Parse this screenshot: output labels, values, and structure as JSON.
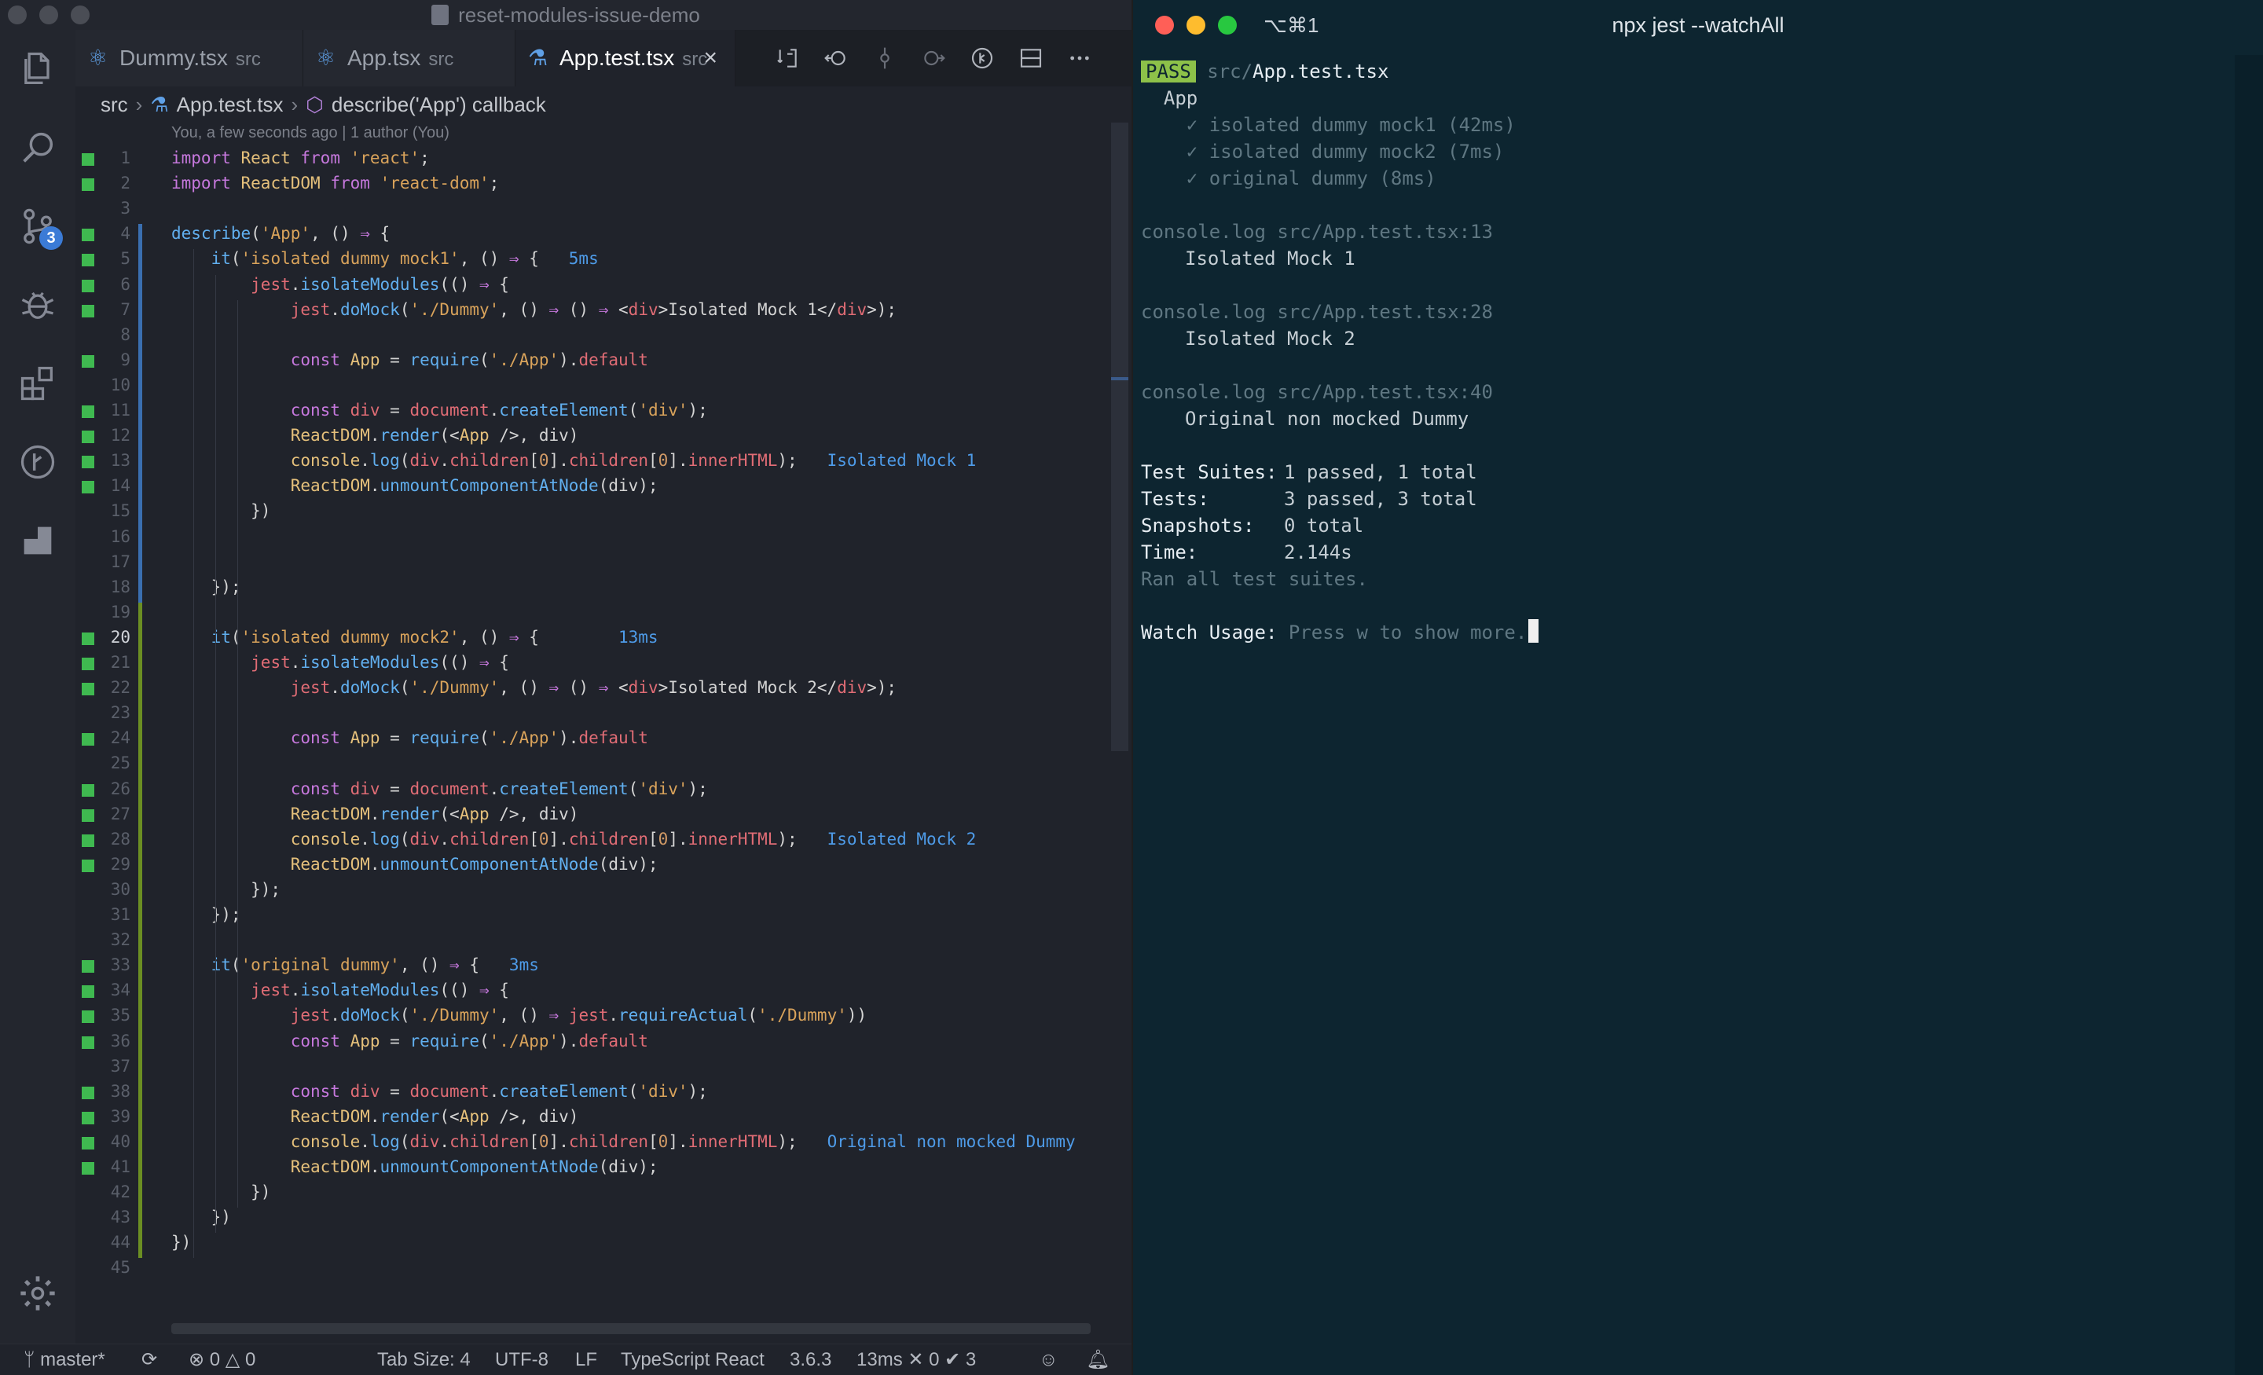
{
  "vscode": {
    "window_title": "reset-modules-issue-demo",
    "tabs": [
      {
        "label": "Dummy.tsx",
        "dir": "src",
        "active": false
      },
      {
        "label": "App.tsx",
        "dir": "src",
        "active": false
      },
      {
        "label": "App.test.tsx",
        "dir": "src",
        "active": true,
        "close": "×"
      }
    ],
    "breadcrumb": {
      "folder": "src",
      "file": "App.test.tsx",
      "symbol": "describe('App') callback"
    },
    "blame": "You, a few seconds ago | 1 author (You)",
    "activity_badge": "3",
    "inline_results": {
      "t1_time": "5ms",
      "t1_log": "Isolated Mock 1",
      "t2_time": "13ms",
      "t2_log": "Isolated Mock 2",
      "t3_time": "3ms",
      "t3_log": "Original non mocked Dummy"
    },
    "line_numbers": [
      "1",
      "2",
      "3",
      "4",
      "5",
      "6",
      "7",
      "8",
      "9",
      "10",
      "11",
      "12",
      "13",
      "14",
      "15",
      "16",
      "17",
      "18",
      "19",
      "20",
      "21",
      "22",
      "23",
      "24",
      "25",
      "26",
      "27",
      "28",
      "29",
      "30",
      "31",
      "32",
      "33",
      "34",
      "35",
      "36",
      "37",
      "38",
      "39",
      "40",
      "41",
      "42",
      "43",
      "44",
      "45"
    ],
    "status": {
      "branch": "master*",
      "errors": "0",
      "warnings": "0",
      "tab_size": "Tab Size: 4",
      "encoding": "UTF-8",
      "eol": "LF",
      "language": "TypeScript React",
      "version": "3.6.3",
      "jest_time": "13ms",
      "jest_fail": "✕ 0",
      "jest_pass": "✔ 3"
    },
    "colors": {
      "accent": "#3b7bd6",
      "gutter_added": "#3fb950"
    }
  },
  "terminal": {
    "shortcut": "⌥⌘1",
    "title": "npx jest --watchAll",
    "pass_badge": "PASS",
    "test_path_dir": "src/",
    "test_path_file": "App.test.tsx",
    "suite": "App",
    "results": [
      "✓ isolated dummy mock1 (42ms)",
      "✓ isolated dummy mock2 (7ms)",
      "✓ original dummy (8ms)"
    ],
    "logs": [
      {
        "src": "console.log src/App.test.tsx:13",
        "msg": "Isolated Mock 1"
      },
      {
        "src": "console.log src/App.test.tsx:28",
        "msg": "Isolated Mock 2"
      },
      {
        "src": "console.log src/App.test.tsx:40",
        "msg": "Original non mocked Dummy"
      }
    ],
    "summary": {
      "suites_label": "Test Suites:",
      "suites_val": "1 passed, 1 total",
      "tests_label": "Tests:",
      "tests_val": "3 passed, 3 total",
      "snap_label": "Snapshots:",
      "snap_val": "0 total",
      "time_label": "Time:",
      "time_val": "2.144s",
      "ran": "Ran all test suites."
    },
    "watch_label": "Watch Usage:",
    "watch_hint": "Press w to show more.",
    "colors": {
      "pass_bg": "#8dc149",
      "bg": "#0d2530"
    }
  }
}
